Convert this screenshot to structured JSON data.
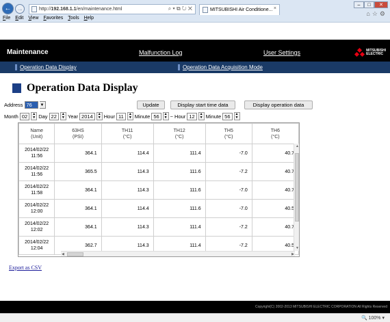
{
  "browser": {
    "url_prefix": "http://",
    "url_host": "192.168.1.1",
    "url_path": "/en/maintenance.html",
    "url_controls": "⌕ ▾ ⧉ ↻ ✕",
    "tab_title": "MITSUBISHI Air Conditione...",
    "menu": [
      "File",
      "Edit",
      "View",
      "Favorites",
      "Tools",
      "Help"
    ],
    "zoom": "100%"
  },
  "header": {
    "title": "Maintenance",
    "links": [
      "Malfunction Log",
      "User Settings"
    ],
    "brand": [
      "MITSUBISHI",
      "ELECTRIC"
    ]
  },
  "subnav": {
    "links": [
      "Operation Data Display",
      "Operation Data Acquisition Mode"
    ]
  },
  "page_title": "Operation Data Display",
  "form": {
    "address_label": "Address",
    "address_value": "76",
    "month_label": "Month",
    "month_value": "02",
    "day_label": "Day",
    "day_value": "22",
    "year_label": "Year",
    "year_value": "2014",
    "hour_label": "Hour",
    "hour_value": "11",
    "minute_label": "Minute",
    "minute_value": "56",
    "tilde": "~",
    "hour2_label": "Hour",
    "hour2_value": "12",
    "minute2_label": "Minute",
    "minute2_value": "56",
    "update_button": "Update",
    "start_time_button": "Display start time data",
    "operation_button": "Display operation data"
  },
  "table": {
    "columns": [
      {
        "name": "Name",
        "unit": "(Unit)"
      },
      {
        "name": "63HS",
        "unit": "(PSI)"
      },
      {
        "name": "TH11",
        "unit": "(°C)"
      },
      {
        "name": "TH12",
        "unit": "(°C)"
      },
      {
        "name": "TH5",
        "unit": "(°C)"
      },
      {
        "name": "TH6",
        "unit": "(°C)"
      }
    ],
    "rows": [
      {
        "date": "2014/02/22",
        "time": "11:56",
        "v": [
          "364.1",
          "114.4",
          "111.4",
          "-7.0",
          "40.7"
        ]
      },
      {
        "date": "2014/02/22",
        "time": "11:56",
        "v": [
          "365.5",
          "114.3",
          "111.6",
          "-7.2",
          "40.7"
        ]
      },
      {
        "date": "2014/02/22",
        "time": "11:58",
        "v": [
          "364.1",
          "114.3",
          "111.6",
          "-7.0",
          "40.7"
        ]
      },
      {
        "date": "2014/02/22",
        "time": "12:00",
        "v": [
          "364.1",
          "114.4",
          "111.6",
          "-7.0",
          "40.5"
        ]
      },
      {
        "date": "2014/02/22",
        "time": "12:02",
        "v": [
          "364.1",
          "114.3",
          "111.4",
          "-7.2",
          "40.7"
        ]
      },
      {
        "date": "2014/02/22",
        "time": "12:04",
        "v": [
          "362.7",
          "114.3",
          "111.4",
          "-7.2",
          "40.5"
        ]
      }
    ]
  },
  "export_link": "Export as CSV",
  "copyright": "Copyright(C) 2002-2013 MITSUBISHI ELECTRIC CORPORATION All Rights Reserved",
  "colors": {
    "header_bg": "#000000",
    "subnav_bg": "#1a3a66",
    "title_square": "#1c3f86",
    "brand_red": "#e60012"
  }
}
